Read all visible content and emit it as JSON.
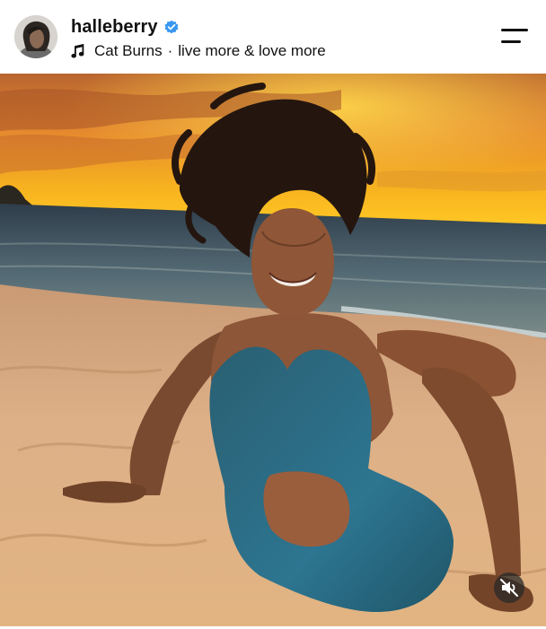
{
  "post": {
    "username": "halleberry",
    "verified": true,
    "audio": {
      "artist": "Cat Burns",
      "separator": "·",
      "track": "live more & love more"
    }
  },
  "icons": {
    "verified": "verified-badge-icon",
    "music": "music-note-icon",
    "menu": "hamburger-menu-icon",
    "mute": "speaker-muted-icon"
  },
  "colors": {
    "verified_blue": "#3897f0",
    "text": "#111111",
    "sky_top": "#c96a2a",
    "sky_glow": "#f6b622",
    "sea": "#3f5b6e",
    "sand": "#d9a574",
    "outfit": "#2e6f86"
  },
  "media": {
    "description_hidden": true
  }
}
